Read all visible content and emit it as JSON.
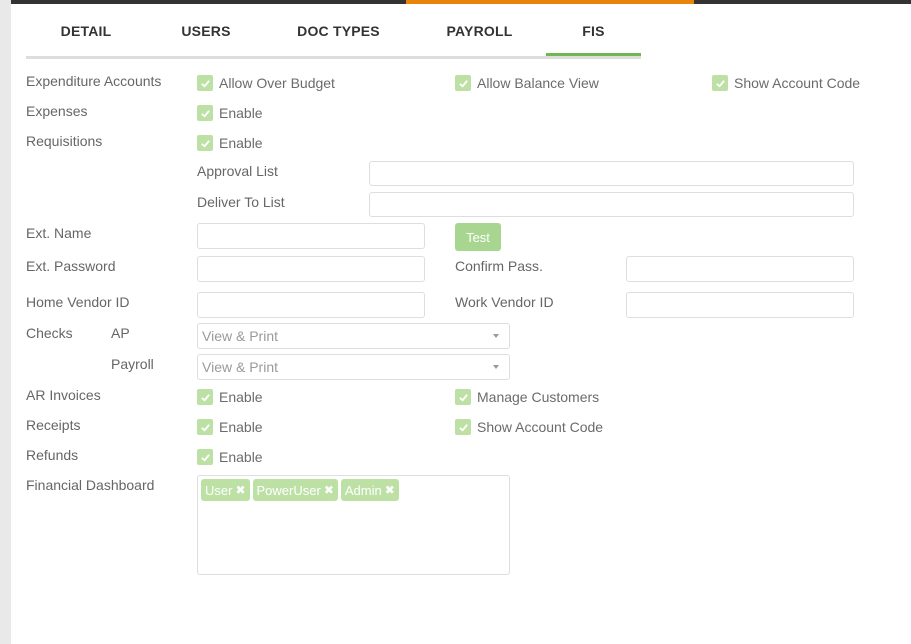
{
  "tabs": [
    {
      "label": "DETAIL"
    },
    {
      "label": "USERS"
    },
    {
      "label": "DOC TYPES"
    },
    {
      "label": "PAYROLL"
    },
    {
      "label": "FIS"
    }
  ],
  "active_tab": "FIS",
  "colors": {
    "accent_green": "#6fb850",
    "checkbox_green": "#bde1a5",
    "button_green": "#a8d690",
    "top_accent_orange": "#e8830b",
    "top_bar_dark": "#333333"
  },
  "expenditure": {
    "label": "Expenditure Accounts",
    "allow_over_budget": "Allow Over Budget",
    "allow_balance_view": "Allow Balance View",
    "show_account_code": "Show Account Code"
  },
  "expenses": {
    "label": "Expenses",
    "enable": "Enable"
  },
  "requisitions": {
    "label": "Requisitions",
    "enable": "Enable",
    "approval_list_label": "Approval List",
    "approval_list_value": "",
    "deliver_to_list_label": "Deliver To List",
    "deliver_to_list_value": ""
  },
  "ext": {
    "name_label": "Ext. Name",
    "name_value": "",
    "test_button": "Test",
    "password_label": "Ext. Password",
    "password_value": "",
    "confirm_label": "Confirm Pass.",
    "confirm_value": ""
  },
  "vendor": {
    "home_label": "Home Vendor ID",
    "home_value": "",
    "work_label": "Work Vendor ID",
    "work_value": ""
  },
  "checks": {
    "label": "Checks",
    "ap_label": "AP",
    "ap_value": "View & Print",
    "payroll_label": "Payroll",
    "payroll_value": "View & Print"
  },
  "ar_invoices": {
    "label": "AR Invoices",
    "enable": "Enable",
    "manage_customers": "Manage Customers"
  },
  "receipts": {
    "label": "Receipts",
    "enable": "Enable",
    "show_account_code": "Show Account Code"
  },
  "refunds": {
    "label": "Refunds",
    "enable": "Enable"
  },
  "financial_dashboard": {
    "label": "Financial Dashboard",
    "tags": [
      "User",
      "PowerUser",
      "Admin"
    ],
    "remove_glyph": "✖"
  }
}
